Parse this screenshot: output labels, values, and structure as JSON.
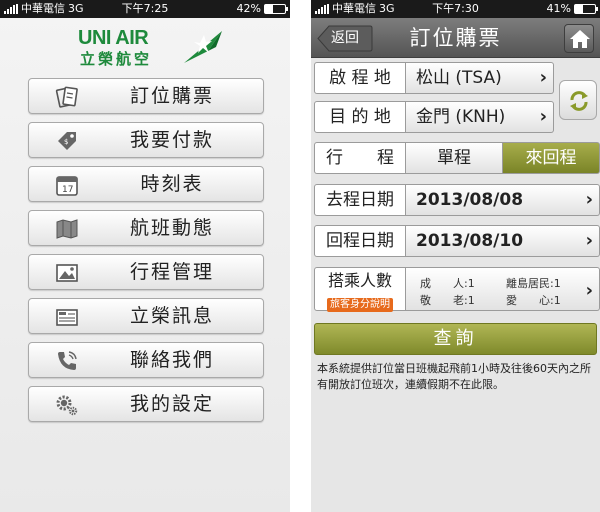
{
  "left_screen": {
    "status": {
      "carrier": "中華電信",
      "network": "3G",
      "time": "下午7:25",
      "battery": "42%",
      "battery_level": 0.42
    },
    "logo": {
      "en": "UNI AIR",
      "zh": "立榮航空"
    },
    "brand_color": "#1e8a3c",
    "menu": [
      {
        "label": "訂位購票",
        "icon": "ticket-icon"
      },
      {
        "label": "我要付款",
        "icon": "price-tag-icon"
      },
      {
        "label": "時刻表",
        "icon": "calendar-icon"
      },
      {
        "label": "航班動態",
        "icon": "map-icon"
      },
      {
        "label": "行程管理",
        "icon": "photo-icon"
      },
      {
        "label": "立榮訊息",
        "icon": "newspaper-icon"
      },
      {
        "label": "聯絡我們",
        "icon": "phone-icon"
      },
      {
        "label": "我的設定",
        "icon": "gear-icon"
      }
    ]
  },
  "right_screen": {
    "status": {
      "carrier": "中華電信",
      "network": "3G",
      "time": "下午7:30",
      "battery": "41%",
      "battery_level": 0.41
    },
    "nav": {
      "back_label": "返回",
      "title": "訂位購票"
    },
    "origin": {
      "label": "啟 程 地",
      "value": "松山 (TSA)"
    },
    "destination": {
      "label": "目 的 地",
      "value": "金門 (KNH)"
    },
    "trip_type": {
      "label": "行　　程",
      "options": [
        "單程",
        "來回程"
      ],
      "selected": "來回程"
    },
    "depart_date": {
      "label": "去程日期",
      "value": "2013/08/08"
    },
    "return_date": {
      "label": "回程日期",
      "value": "2013/08/10"
    },
    "passengers": {
      "label": "搭乘人數",
      "help_label": "旅客身分說明",
      "items": [
        {
          "name": "成　　人",
          "count": ":1"
        },
        {
          "name": "離島居民",
          "count": ":1"
        },
        {
          "name": "敬　　老",
          "count": ":1"
        },
        {
          "name": "愛　　心",
          "count": ":1"
        }
      ]
    },
    "query_label": "查詢",
    "note": "本系統提供訂位當日班機起飛前1小時及往後60天內之所有開放訂位班次，連續假期不在此限。",
    "accent_color": "#7f8a2b"
  }
}
